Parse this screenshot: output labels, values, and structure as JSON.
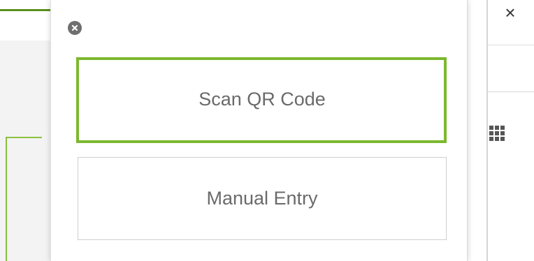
{
  "popup": {
    "close_icon": "close-circle-icon",
    "options": [
      {
        "label": "Scan QR Code",
        "highlighted": true
      },
      {
        "label": "Manual Entry",
        "highlighted": false
      }
    ]
  },
  "window": {
    "close_glyph": "×",
    "grid_icon": "grid-dots-icon"
  },
  "colors": {
    "highlight": "#7cb82f",
    "button_text": "#6a6a6a",
    "button_border": "#cfcfcf",
    "annotation_dark": "#5a8f1e"
  }
}
